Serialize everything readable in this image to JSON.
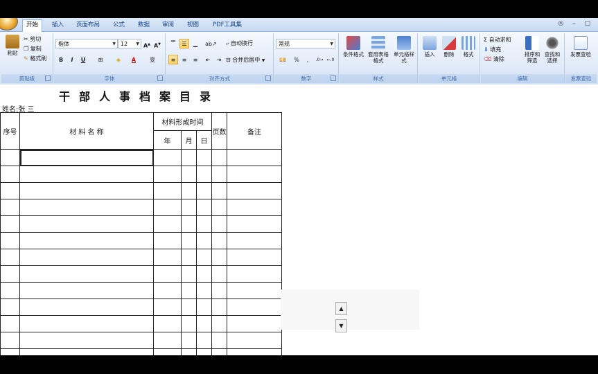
{
  "tabs": [
    "开始",
    "插入",
    "页面布局",
    "公式",
    "数据",
    "审阅",
    "视图",
    "PDF工具集"
  ],
  "window_controls": "◎ – ▢",
  "ribbon": {
    "clipboard": {
      "label": "剪贴板",
      "paste": "粘贴",
      "cut": "剪切",
      "copy": "复制",
      "format_painter": "格式刷"
    },
    "font": {
      "label": "字体",
      "name": "楷体",
      "size": "12",
      "bold": "B",
      "italic": "I",
      "underline": "U",
      "wen": "变"
    },
    "alignment": {
      "label": "对齐方式",
      "wrap": "自动换行",
      "merge": "合并后居中"
    },
    "number": {
      "label": "数字",
      "format": "常规",
      "percent": "%",
      "comma": ","
    },
    "styles": {
      "label": "样式",
      "conditional": "条件格式",
      "table": "套用表格格式",
      "cell": "单元格样式"
    },
    "cells": {
      "label": "单元格",
      "insert": "插入",
      "delete": "删除",
      "format": "格式"
    },
    "editing": {
      "label": "编辑",
      "autosum": "Σ 自动求和",
      "fill": "填充",
      "clear": "清除",
      "sort": "排序和筛选",
      "find": "查找和选择"
    },
    "invoice": {
      "label": "发票查验",
      "button": "发票查验"
    }
  },
  "sheet": {
    "title": "干部人事档案目录",
    "person": "姓名:张 三",
    "headers": {
      "index": "序号",
      "name": "材 料 名 称",
      "time": "材料形成时间",
      "year": "年",
      "month": "月",
      "day": "日",
      "pages": "页数",
      "remark": "备注"
    },
    "row_count": 13
  },
  "colors": {
    "accent": "#fbcf5c",
    "ribbon_text": "#3e6aaa"
  }
}
